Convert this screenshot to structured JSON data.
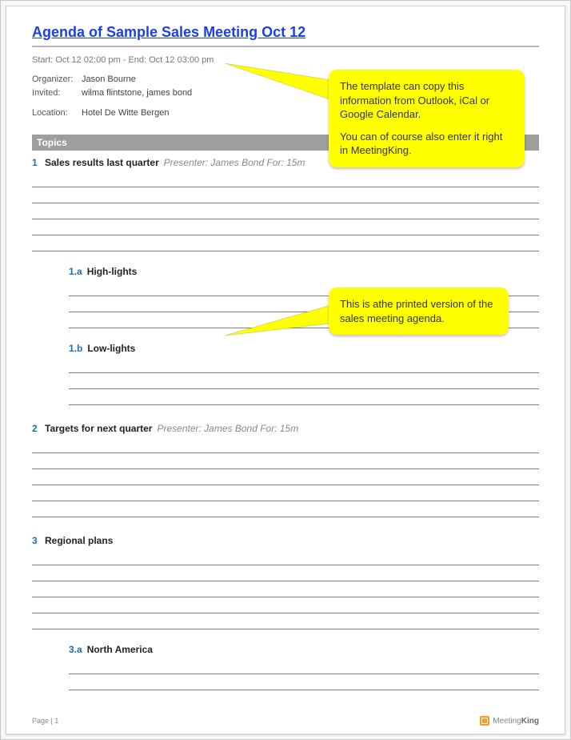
{
  "title": "Agenda of Sample Sales Meeting Oct 12",
  "time_line": "Start: Oct 12 02:00 pm - End: Oct 12 03:00 pm",
  "meta": {
    "organizer_label": "Organizer:",
    "organizer_value": "Jason Bourne",
    "invited_label": "Invited:",
    "invited_value": "wilma flintstone, james bond",
    "location_label": "Location:",
    "location_value": "Hotel De Witte Bergen"
  },
  "section_topics": "Topics",
  "topics": [
    {
      "num": "1",
      "name": "Sales results last quarter",
      "meta": "Presenter: James Bond For: 15m",
      "sub": [
        {
          "num": "1.a",
          "name": "High-lights"
        },
        {
          "num": "1.b",
          "name": "Low-lights"
        }
      ]
    },
    {
      "num": "2",
      "name": "Targets for next quarter",
      "meta": "Presenter: James Bond For: 15m",
      "sub": []
    },
    {
      "num": "3",
      "name": "Regional plans",
      "meta": "",
      "sub": [
        {
          "num": "3.a",
          "name": "North America"
        }
      ]
    }
  ],
  "footer": {
    "page": "Page | 1",
    "brand_prefix": "Meeting",
    "brand_suffix": "King"
  },
  "callouts": {
    "c1_p1": "The template can copy this information from Outlook, iCal or Google Calendar.",
    "c1_p2": "You can of course also enter it right in MeetingKing.",
    "c2": "This is athe printed version of the sales meeting agenda."
  }
}
